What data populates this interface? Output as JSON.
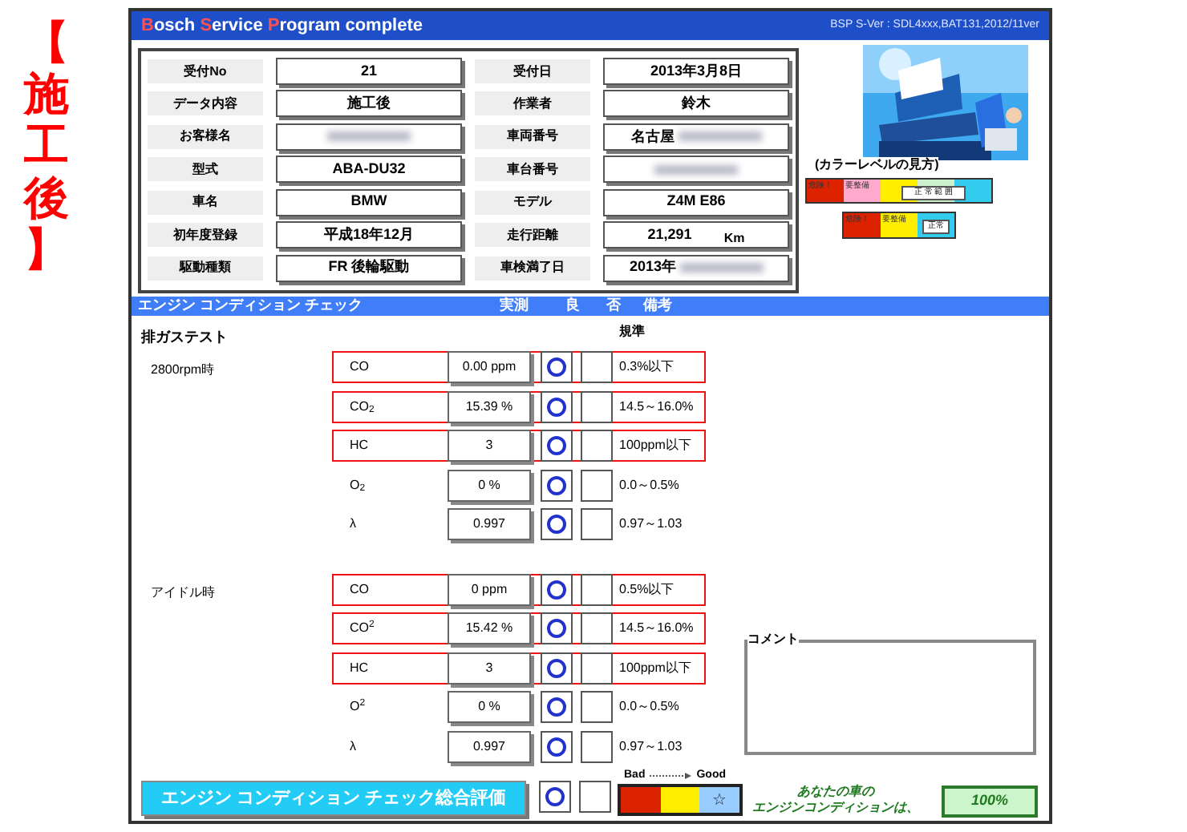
{
  "stamp": "【施工後】",
  "title": {
    "parts": [
      {
        "text": "B",
        "accent": true
      },
      {
        "text": "osch ",
        "accent": false
      },
      {
        "text": "S",
        "accent": true
      },
      {
        "text": "ervice ",
        "accent": false
      },
      {
        "text": "P",
        "accent": true
      },
      {
        "text": "rogram complete",
        "accent": false
      }
    ],
    "version": "BSP S-Ver : SDL4xxx,BAT131,2012/11ver"
  },
  "info": [
    {
      "label": "受付No",
      "value": "21"
    },
    {
      "label": "受付日",
      "value": "2013年3月8日"
    },
    {
      "label": "データ内容",
      "value": "施工後"
    },
    {
      "label": "作業者",
      "value": "鈴木"
    },
    {
      "label": "お客様名",
      "redacted": true
    },
    {
      "label": "車両番号",
      "value": "名古屋",
      "redacted": true
    },
    {
      "label": "型式",
      "value": "ABA-DU32"
    },
    {
      "label": "車台番号",
      "redacted": true
    },
    {
      "label": "車名",
      "value": "BMW"
    },
    {
      "label": "モデル",
      "value": "Z4M E86"
    },
    {
      "label": "初年度登録",
      "value": "平成18年12月"
    },
    {
      "label": "走行距離",
      "value": "21,291",
      "unit": "Km"
    },
    {
      "label": "駆動種類",
      "value": "FR 後輪駆動"
    },
    {
      "label": "車検満了日",
      "value": "2013年",
      "redacted": true
    }
  ],
  "legend": {
    "title": "(カラーレベルの見方)",
    "scales": [
      {
        "segments": [
          {
            "color": "#dd2200",
            "text": "危険！"
          },
          {
            "color": "#ffaacc",
            "text": "要整備"
          },
          {
            "color": "#ffee00"
          },
          {
            "color": "#ccf0cc",
            "label": "正 常 範 囲"
          },
          {
            "color": "#33ccee"
          }
        ]
      },
      {
        "segments": [
          {
            "color": "#dd2200",
            "text": "危険！"
          },
          {
            "color": "#ffee00",
            "text": "要整備"
          },
          {
            "color": "#33ccee",
            "label": "正常"
          }
        ]
      }
    ]
  },
  "section": {
    "title": "エンジン コンディション チェック",
    "columns": [
      "実測",
      "良",
      "否",
      "備考"
    ]
  },
  "test_title": "排ガステスト",
  "standard_heading": "規準",
  "groups": [
    {
      "label": "2800rpm時",
      "rows": [
        {
          "item": "CO",
          "value": "0.00 ppm",
          "good": true,
          "highlighted": true,
          "standard": "0.3%以下"
        },
        {
          "item": "CO$_{2}$",
          "value": "15.39 %",
          "good": true,
          "highlighted": true,
          "standard": "14.5～16.0%"
        },
        {
          "item": "HC",
          "value": "3",
          "good": true,
          "highlighted": true,
          "standard": "100ppm以下"
        },
        {
          "item": "O$_{2}$",
          "value": "0 %",
          "good": true,
          "highlighted": false,
          "standard": "0.0～0.5%"
        },
        {
          "item": "λ",
          "value": "0.997",
          "good": true,
          "highlighted": false,
          "standard": "0.97～1.03"
        }
      ]
    },
    {
      "label": "アイドル時",
      "rows": [
        {
          "item": "CO",
          "value": "0 ppm",
          "good": true,
          "highlighted": true,
          "standard": "0.5%以下"
        },
        {
          "item": "CO$^{2}$",
          "value": "15.42 %",
          "good": true,
          "highlighted": true,
          "standard": "14.5～16.0%"
        },
        {
          "item": "HC",
          "value": "3",
          "good": true,
          "highlighted": true,
          "standard": "100ppm以下"
        },
        {
          "item": "O$^{2}$",
          "value": "0 %",
          "good": true,
          "highlighted": false,
          "standard": "0.0～0.5%"
        },
        {
          "item": "λ",
          "value": "0.997",
          "good": true,
          "highlighted": false,
          "standard": "0.97～1.03"
        }
      ]
    }
  ],
  "comment": {
    "label": "コメント"
  },
  "overall": {
    "button": "エンジン コンディション チェック総合評価",
    "good": true,
    "bad_label": "Bad",
    "good_label": "Good",
    "segments": [
      {
        "color": "#dd2200"
      },
      {
        "color": "#ffee00"
      },
      {
        "color": "#99ccff",
        "mark": "☆"
      }
    ],
    "message": [
      "あなたの車の",
      "エンジンコンディションは、"
    ],
    "score": "100%"
  }
}
